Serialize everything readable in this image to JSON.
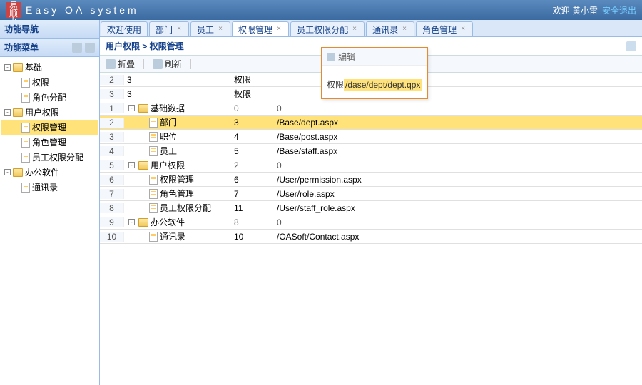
{
  "brand": {
    "badge_l1": "易顺",
    "badge_l2": "办公",
    "title": "Easy OA system"
  },
  "header": {
    "welcome": "欢迎 黄小雷",
    "logout": "安全退出"
  },
  "sidebar": {
    "nav_title": "功能导航",
    "menu_title": "功能菜单",
    "groups": [
      {
        "label": "基础",
        "items": [
          {
            "label": "权限"
          },
          {
            "label": "角色分配"
          }
        ]
      },
      {
        "label": "用户权限",
        "items": [
          {
            "label": "权限管理",
            "selected": true
          },
          {
            "label": "角色管理"
          },
          {
            "label": "员工权限分配"
          }
        ]
      },
      {
        "label": "办公软件",
        "items": [
          {
            "label": "通讯录"
          }
        ]
      }
    ]
  },
  "tabs": [
    {
      "label": "欢迎使用",
      "closable": false
    },
    {
      "label": "部门",
      "closable": true
    },
    {
      "label": "员工",
      "closable": true
    },
    {
      "label": "权限管理",
      "closable": true,
      "active": true
    },
    {
      "label": "员工权限分配",
      "closable": true
    },
    {
      "label": "通讯录",
      "closable": true
    },
    {
      "label": "角色管理",
      "closable": true
    }
  ],
  "breadcrumb": "用户权限 > 权限管理",
  "toolbar": {
    "collapse": "折叠",
    "refresh": "刷新"
  },
  "pre_rows": [
    {
      "num": "2",
      "c1": "3",
      "c2": "",
      "c3": ""
    },
    {
      "num": "3",
      "c1": "3",
      "c2": "",
      "c3": ""
    }
  ],
  "col2_label": "权限",
  "grid": [
    {
      "num": "1",
      "type": "group",
      "label": "基础数据",
      "id": "0",
      "url": "0"
    },
    {
      "num": "2",
      "type": "item",
      "label": "部门",
      "id": "3",
      "url": "/Base/dept.aspx",
      "selected": true
    },
    {
      "num": "3",
      "type": "item",
      "label": "职位",
      "id": "4",
      "url": "/Base/post.aspx"
    },
    {
      "num": "4",
      "type": "item",
      "label": "员工",
      "id": "5",
      "url": "/Base/staff.aspx"
    },
    {
      "num": "5",
      "type": "group",
      "label": "用户权限",
      "id": "2",
      "url": "0"
    },
    {
      "num": "6",
      "type": "item",
      "label": "权限管理",
      "id": "6",
      "url": "/User/permission.aspx"
    },
    {
      "num": "7",
      "type": "item",
      "label": "角色管理",
      "id": "7",
      "url": "/User/role.aspx"
    },
    {
      "num": "8",
      "type": "item",
      "label": "员工权限分配",
      "id": "11",
      "url": "/User/staff_role.aspx"
    },
    {
      "num": "9",
      "type": "group",
      "label": "办公软件",
      "id": "8",
      "url": "0"
    },
    {
      "num": "10",
      "type": "item",
      "label": "通讯录",
      "id": "10",
      "url": "/OASoft/Contact.aspx"
    }
  ],
  "popup": {
    "title": "编辑",
    "field_label": "权限",
    "field_value": "/dase/dept/dept.qpx"
  }
}
